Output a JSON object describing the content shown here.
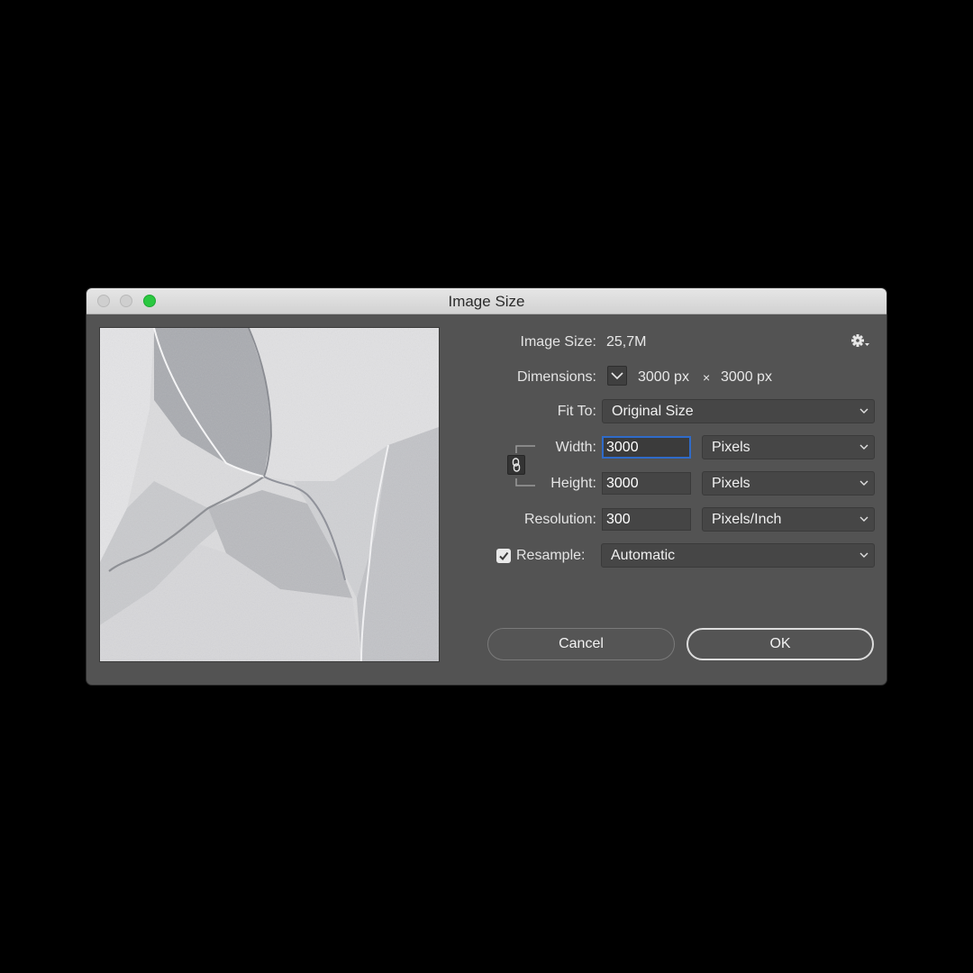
{
  "window": {
    "title": "Image Size"
  },
  "info": {
    "image_size_label": "Image Size:",
    "image_size_value": "25,7M",
    "dimensions_label": "Dimensions:",
    "dimensions_width": "3000 px",
    "dimensions_times": "×",
    "dimensions_height": "3000 px"
  },
  "fit_to": {
    "label": "Fit To:",
    "value": "Original Size"
  },
  "width": {
    "label": "Width:",
    "value": "3000",
    "unit": "Pixels"
  },
  "height": {
    "label": "Height:",
    "value": "3000",
    "unit": "Pixels"
  },
  "resolution": {
    "label": "Resolution:",
    "value": "300",
    "unit": "Pixels/Inch"
  },
  "resample": {
    "label": "Resample:",
    "checked": true,
    "value": "Automatic"
  },
  "buttons": {
    "cancel": "Cancel",
    "ok": "OK"
  },
  "icons": {
    "settings": "gear-icon",
    "dimensions_toggle": "chevron-down-icon",
    "constrain": "link-icon",
    "resample_check": "checkmark-icon"
  },
  "colors": {
    "dialog_bg": "#535353",
    "focus_ring": "#2f6bc9",
    "maximize_button": "#2ac840"
  }
}
